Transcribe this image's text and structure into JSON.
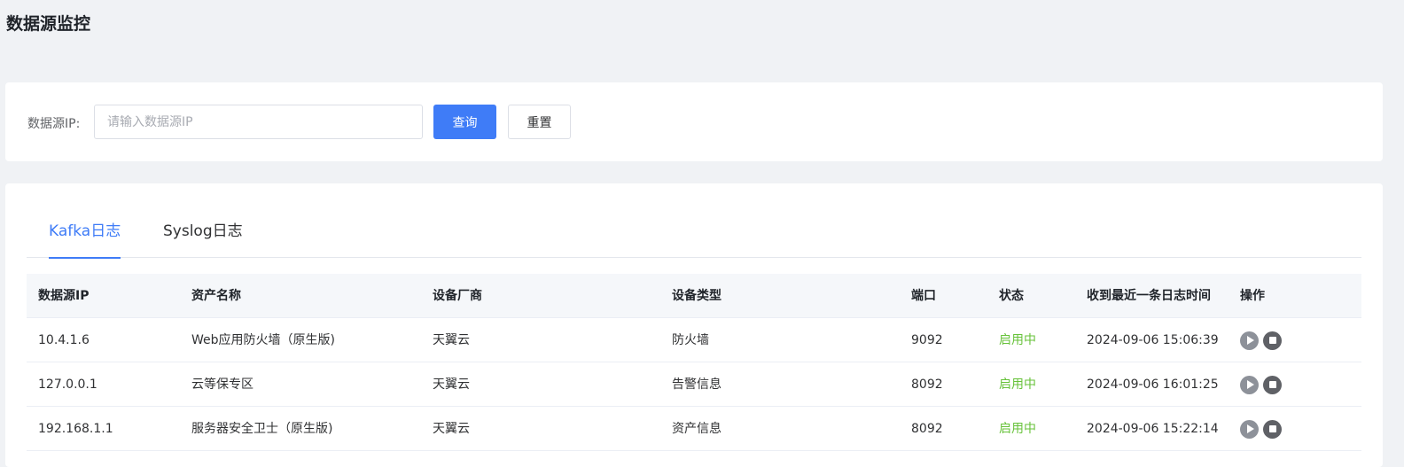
{
  "page": {
    "title": "数据源监控"
  },
  "search": {
    "label": "数据源IP:",
    "value": "",
    "placeholder": "请输入数据源IP",
    "query_label": "查询",
    "reset_label": "重置"
  },
  "tabs": [
    {
      "label": "Kafka日志",
      "active": true
    },
    {
      "label": "Syslog日志",
      "active": false
    }
  ],
  "table": {
    "headers": [
      "数据源IP",
      "资产名称",
      "设备厂商",
      "设备类型",
      "端口",
      "状态",
      "收到最近一条日志时间",
      "操作"
    ],
    "rows": [
      {
        "ip": "10.4.1.6",
        "asset": "Web应用防火墙（原生版)",
        "vendor": "天翼云",
        "type": "防火墙",
        "port": "9092",
        "status": "启用中",
        "time": "2024-09-06 15:06:39"
      },
      {
        "ip": "127.0.0.1",
        "asset": "云等保专区",
        "vendor": "天翼云",
        "type": "告警信息",
        "port": "8092",
        "status": "启用中",
        "time": "2024-09-06 16:01:25"
      },
      {
        "ip": "192.168.1.1",
        "asset": "服务器安全卫士（原生版)",
        "vendor": "天翼云",
        "type": "资产信息",
        "port": "8092",
        "status": "启用中",
        "time": "2024-09-06 15:22:14"
      }
    ],
    "actions": [
      "play-icon",
      "stop-icon"
    ]
  },
  "colors": {
    "accent": "#3f7cf7",
    "status_enabled": "#67c23a",
    "background": "#f0f2f5"
  }
}
